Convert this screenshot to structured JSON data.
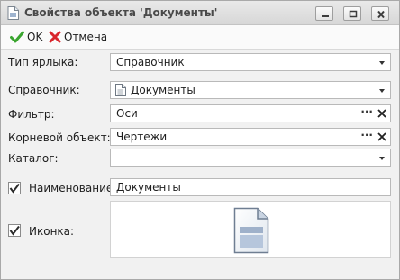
{
  "window": {
    "title": "Свойства объекта 'Документы'",
    "controls": [
      "minimize",
      "maximize",
      "close"
    ]
  },
  "toolbar": {
    "ok_label": "OK",
    "cancel_label": "Отмена"
  },
  "form": {
    "shortcut_type": {
      "label": "Тип ярлыка:",
      "value": "Справочник"
    },
    "directory": {
      "label": "Справочник:",
      "value": "Документы",
      "icon": "document-icon"
    },
    "filter": {
      "label": "Фильтр:",
      "value": "Оси",
      "ellipsis": "···"
    },
    "root_object": {
      "label": "Корневой объект:",
      "value": "Чертежи",
      "ellipsis": "···"
    },
    "catalog": {
      "label": "Каталог:",
      "value": ""
    },
    "name": {
      "label": "Наименование:",
      "value": "Документы",
      "checked": true
    },
    "icon": {
      "label": "Иконка:",
      "checked": true,
      "preview": "document-icon"
    }
  },
  "colors": {
    "ok_green": "#3aa52f",
    "cancel_red": "#d9262c",
    "window_bg": "#f1f1f1"
  }
}
